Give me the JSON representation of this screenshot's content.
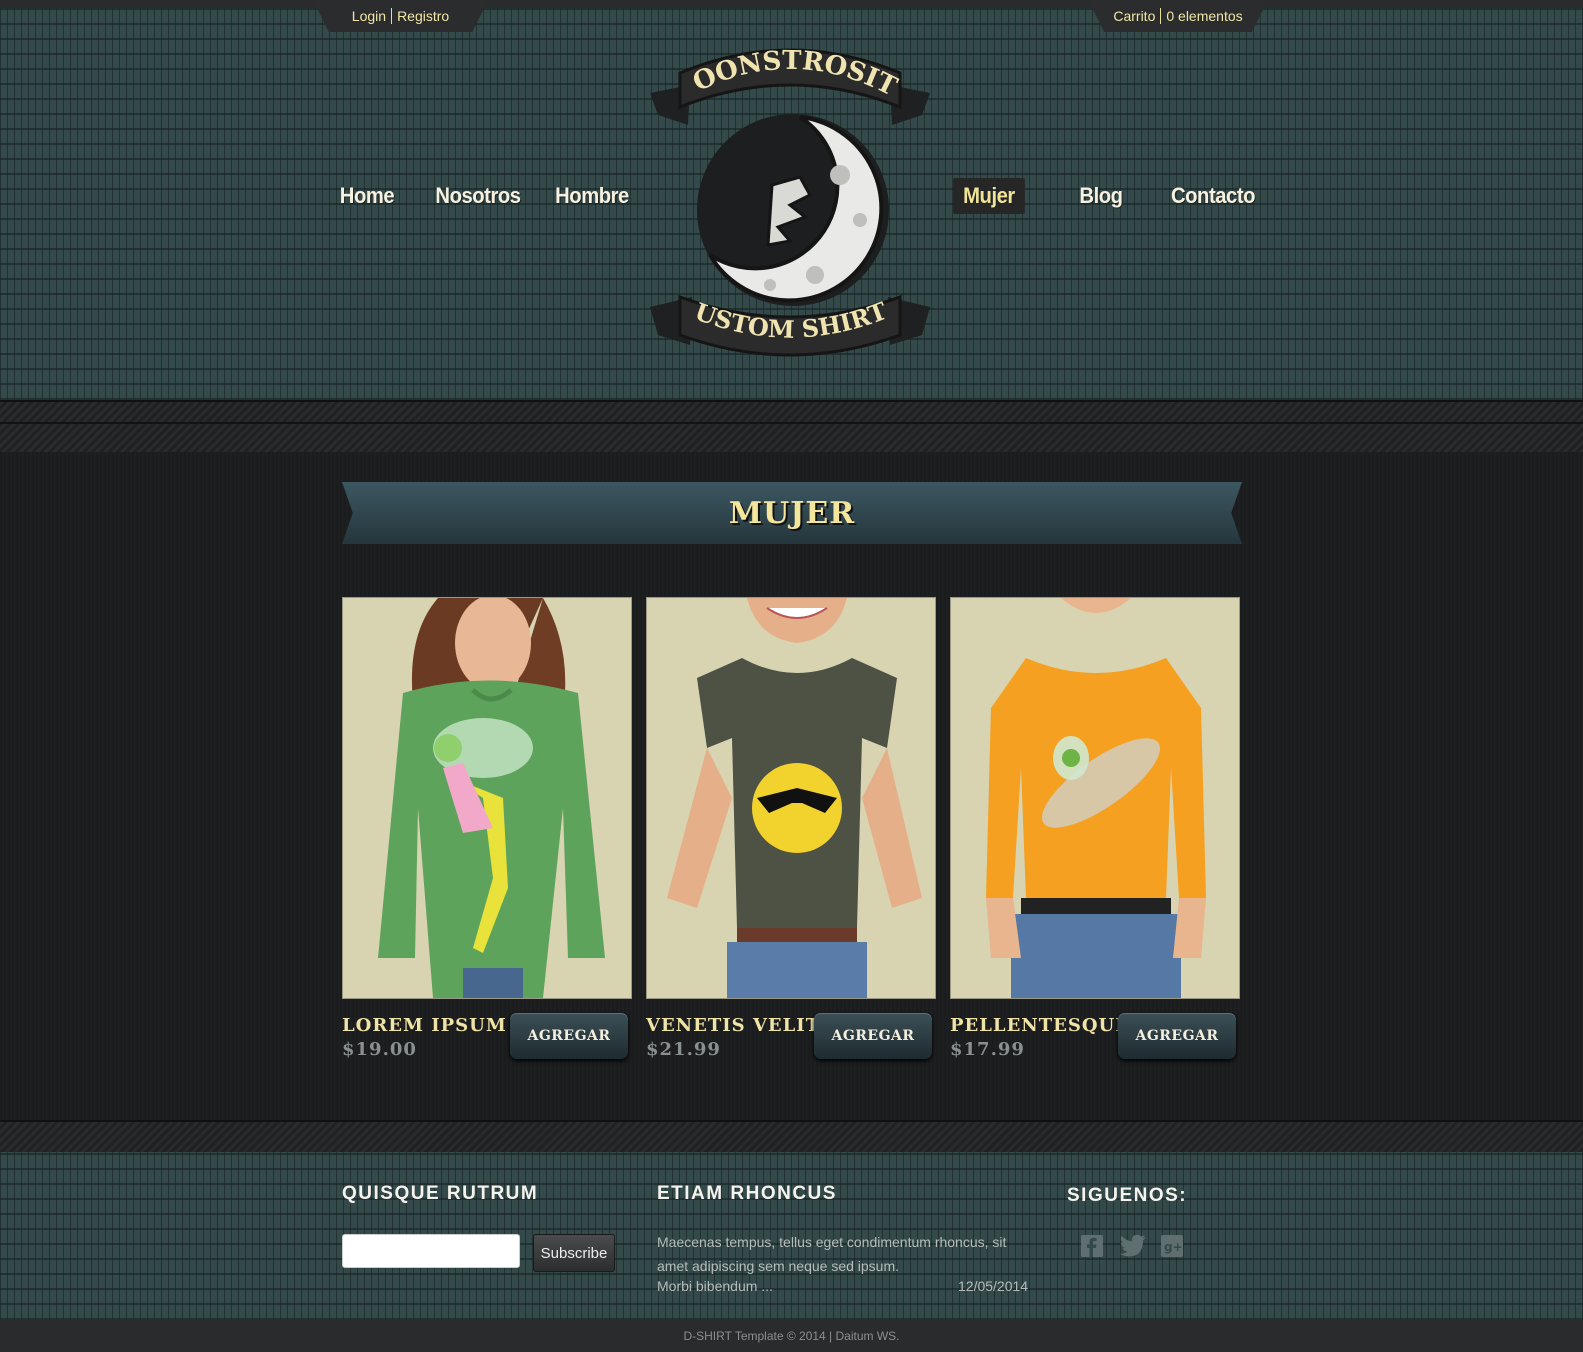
{
  "top_bar": {
    "login": "Login",
    "register": "Registro",
    "cart": "Carrito",
    "cart_count": "0 elementos"
  },
  "logo": {
    "top_text": "MOONSTROSITY",
    "bottom_text": "CUSTOM SHIRTS"
  },
  "nav": {
    "items": [
      {
        "label": "Home",
        "active": false
      },
      {
        "label": "Nosotros",
        "active": false
      },
      {
        "label": "Hombre",
        "active": false
      },
      {
        "label": "Mujer",
        "active": true
      },
      {
        "label": "Blog",
        "active": false
      },
      {
        "label": "Contacto",
        "active": false
      }
    ]
  },
  "section": {
    "title": "MUJER"
  },
  "products": [
    {
      "name": "LOREM IPSUM",
      "price": "$19.00",
      "button": "AGREGAR",
      "shirt_color": "#5ea35b",
      "graphic": "fairy"
    },
    {
      "name": "VENETIS VELIT",
      "price": "$21.99",
      "button": "AGREGAR",
      "shirt_color": "#4d5245",
      "graphic": "sun"
    },
    {
      "name": "PELLENTESQUE",
      "price": "$17.99",
      "button": "AGREGAR",
      "shirt_color": "#f5a020",
      "graphic": "ufo"
    }
  ],
  "footer": {
    "col1_title": "QUISQUE RUTRUM",
    "subscribe": "Subscribe",
    "newsletter_value": "",
    "col2_title": "ETIAM RHONCUS",
    "news_text": "Maecenas tempus, tellus eget condimentum rhoncus, sit amet adipiscing sem neque sed ipsum.",
    "news_more": "Morbi bibendum ...",
    "news_date": "12/05/2014",
    "col3_title": "SIGUENOS:",
    "social_icons": [
      "facebook-icon",
      "twitter-icon",
      "google-plus-icon"
    ],
    "copyright": "D-SHIRT Template © 2014 | Daitum WS."
  },
  "colors": {
    "accent": "#f2e397",
    "header_bg": "#344a4a",
    "banner": "#2f4750",
    "page_bg": "#1c1d1e"
  }
}
